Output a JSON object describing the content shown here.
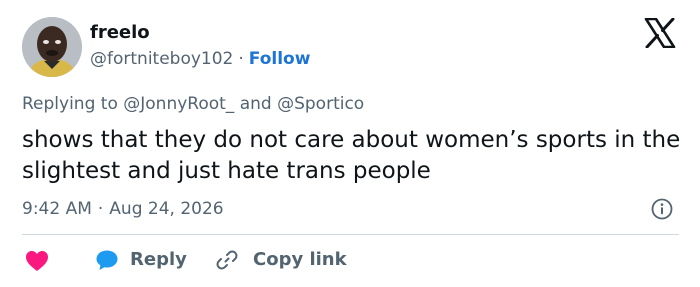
{
  "author": {
    "display_name": "freelo",
    "handle": "@fortniteboy102",
    "separator": "·",
    "follow_label": "Follow"
  },
  "platform_logo": "x-logo-icon",
  "reply_context": {
    "prefix": "Replying to",
    "mention_1": "@JonnyRoot_",
    "conjunction": "and",
    "mention_2": "@Sportico"
  },
  "tweet": {
    "text": "shows that they do not care about women’s sports in the slightest and just hate trans people"
  },
  "meta": {
    "time": "9:42 AM",
    "separator": "·",
    "date": "Aug 24, 2026"
  },
  "actions": {
    "like_icon": "heart-icon",
    "reply_label": "Reply",
    "copy_link_label": "Copy link"
  },
  "colors": {
    "heart": "#f91880",
    "reply_bubble": "#1d9bf0",
    "follow": "#1d74d4",
    "secondary_text": "#536471"
  }
}
